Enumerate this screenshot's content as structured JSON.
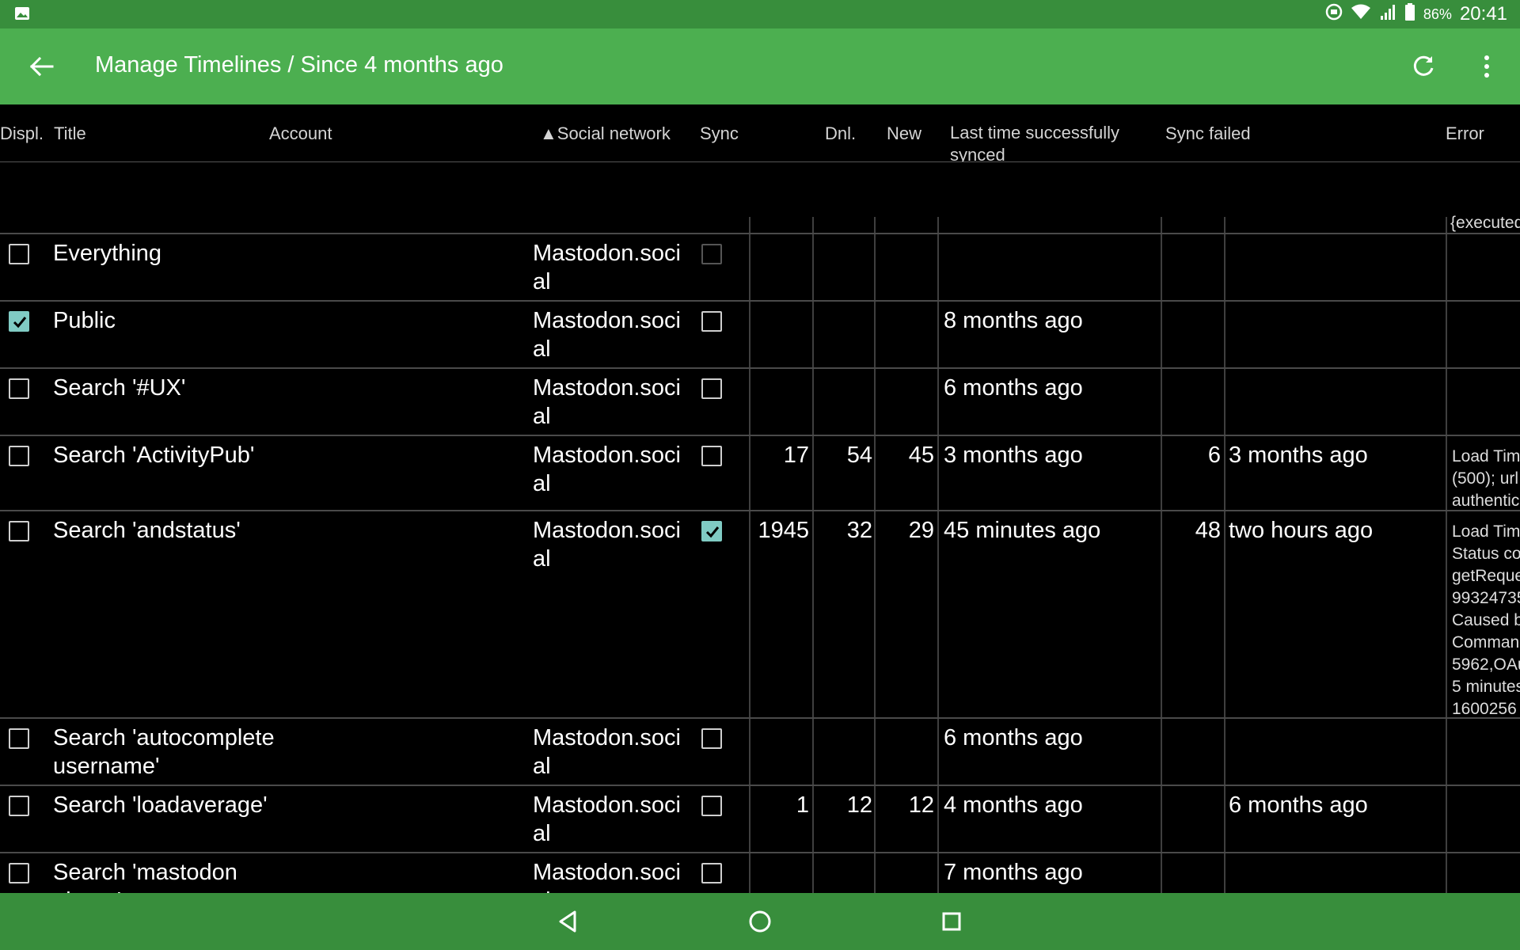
{
  "status_bar": {
    "battery": "86%",
    "time": "20:41",
    "icons": [
      "image-icon",
      "sync-icon",
      "wifi-icon",
      "signal-icon",
      "battery-icon"
    ]
  },
  "app_bar": {
    "title": "Manage Timelines / Since 4 months ago",
    "icons": [
      "back-arrow-icon",
      "refresh-icon",
      "more-vert-icon"
    ]
  },
  "table": {
    "columns": {
      "displ": "Displ.",
      "title": "Title",
      "account": "Account",
      "network": "▲Social network",
      "sync": "Sync",
      "dnl": "Dnl.",
      "new": "New",
      "last_synced": "Last time successfully synced",
      "sync_failed": "Sync failed",
      "error": "Error"
    },
    "summary_error": "{executed",
    "rows": [
      {
        "displayed": false,
        "title": "Everything",
        "network": "Mastodon.social",
        "sync": false,
        "sync_dim": true,
        "count": "",
        "dnl": "",
        "new": "",
        "last_synced": "",
        "failed_count": "",
        "failed_time": "",
        "error": ""
      },
      {
        "displayed": true,
        "title": "Public",
        "network": "Mastodon.social",
        "sync": false,
        "count": "",
        "dnl": "",
        "new": "",
        "last_synced": "8 months ago",
        "failed_count": "",
        "failed_time": "",
        "error": ""
      },
      {
        "displayed": false,
        "title": "Search '#UX'",
        "network": "Mastodon.social",
        "sync": false,
        "count": "",
        "dnl": "",
        "new": "",
        "last_synced": "6 months ago",
        "failed_count": "",
        "failed_time": "",
        "error": ""
      },
      {
        "displayed": false,
        "title": "Search 'ActivityPub'",
        "network": "Mastodon.social",
        "sync": false,
        "count": "17",
        "dnl": "54",
        "new": "45",
        "last_synced": "3 months ago",
        "failed_count": "6",
        "failed_time": "3 months ago",
        "error": "Load Tim\n(500); url\nauthentic"
      },
      {
        "displayed": false,
        "title": "Search 'andstatus'",
        "network": "Mastodon.social",
        "sync": true,
        "count": "1945",
        "dnl": "32",
        "new": "29",
        "last_synced": "45 minutes ago",
        "failed_count": "48",
        "failed_time": "two hours ago",
        "error": "Load Tim\nStatus co\ngetReque\n99324735\nCaused b\nComman\n5962,OAu\n5 minutes\n1600256"
      },
      {
        "displayed": false,
        "title": "Search 'autocomplete username'",
        "network": "Mastodon.social",
        "sync": false,
        "count": "",
        "dnl": "",
        "new": "",
        "last_synced": "6 months ago",
        "failed_count": "",
        "failed_time": "",
        "error": ""
      },
      {
        "displayed": false,
        "title": "Search 'loadaverage'",
        "network": "Mastodon.social",
        "sync": false,
        "count": "1",
        "dnl": "12",
        "new": "12",
        "last_synced": "4 months ago",
        "failed_count": "",
        "failed_time": "6 months ago",
        "error": ""
      },
      {
        "displayed": false,
        "title": "Search 'mastodon phone'",
        "network": "Mastodon.social",
        "sync": false,
        "count": "",
        "dnl": "",
        "new": "",
        "last_synced": "7 months ago",
        "failed_count": "",
        "failed_time": "",
        "error": ""
      }
    ]
  },
  "nav_bar": {
    "icons": [
      "nav-back-icon",
      "nav-home-icon",
      "nav-recents-icon"
    ]
  },
  "colors": {
    "status_bar": "#388e3c",
    "app_bar": "#4caf50",
    "checkbox_checked": "#80cbc4",
    "background": "#000000"
  }
}
